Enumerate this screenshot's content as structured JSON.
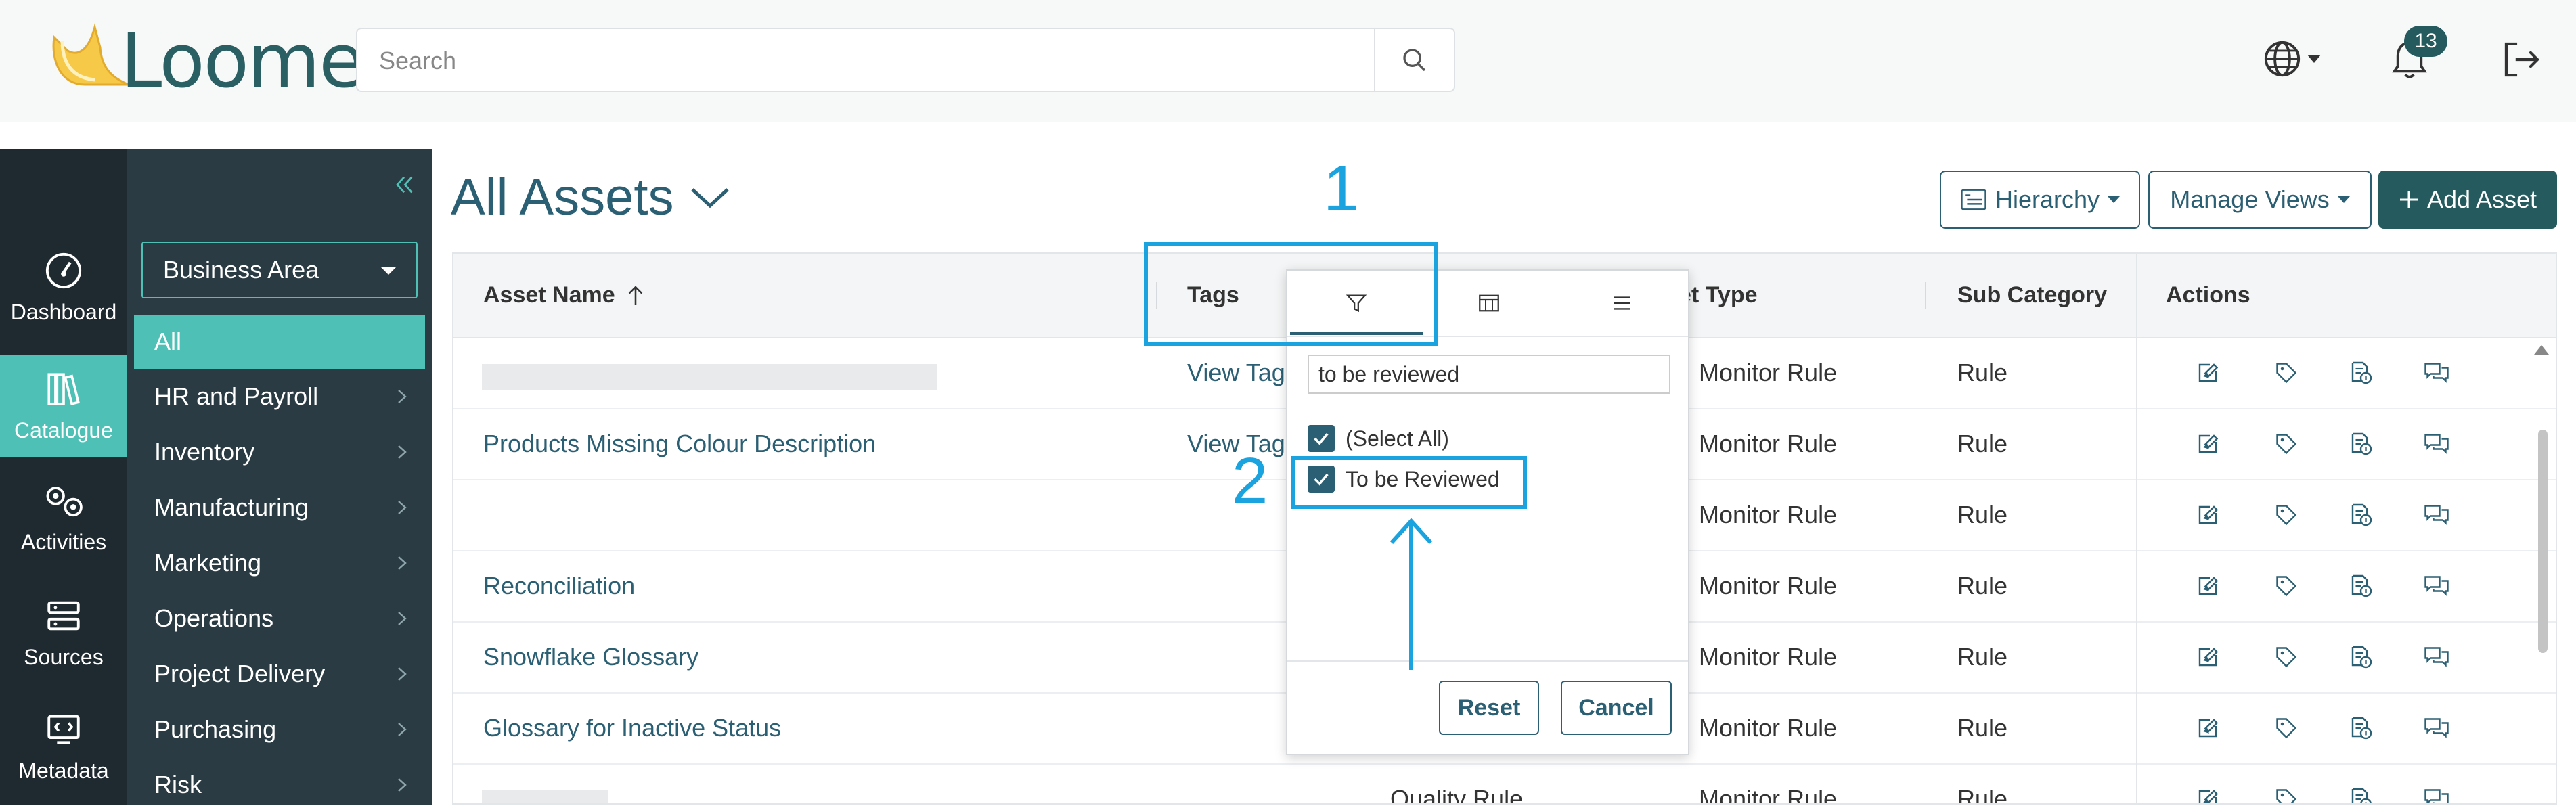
{
  "app": {
    "brand": "Loome"
  },
  "header": {
    "search_placeholder": "Search",
    "notifications_count": "13"
  },
  "rail": {
    "items": [
      {
        "label": "Dashboard",
        "icon": "dashboard-icon"
      },
      {
        "label": "Catalogue",
        "icon": "catalogue-icon",
        "active": true
      },
      {
        "label": "Activities",
        "icon": "activities-icon"
      },
      {
        "label": "Sources",
        "icon": "sources-icon"
      },
      {
        "label": "Metadata",
        "icon": "metadata-icon"
      }
    ]
  },
  "sidebar": {
    "business_area_label": "Business Area",
    "items": [
      {
        "label": "All",
        "active": true
      },
      {
        "label": "HR and Payroll"
      },
      {
        "label": "Inventory"
      },
      {
        "label": "Manufacturing"
      },
      {
        "label": "Marketing"
      },
      {
        "label": "Operations"
      },
      {
        "label": "Project Delivery"
      },
      {
        "label": "Purchasing"
      },
      {
        "label": "Risk"
      }
    ]
  },
  "main": {
    "title": "All Assets",
    "hierarchy_button": "Hierarchy",
    "manage_views_button": "Manage Views",
    "add_asset_button": "Add Asset"
  },
  "table": {
    "columns": {
      "asset_name": "Asset Name",
      "tags": "Tags",
      "asset_type": "et Type",
      "sub_category": "Sub Category",
      "actions": "Actions"
    },
    "rows": [
      {
        "name": "",
        "tags": "View Tags",
        "asset_type": "",
        "type": "Monitor Rule",
        "sub": "Rule"
      },
      {
        "name": "Products Missing Colour Description",
        "tags": "View Tags",
        "asset_type": "",
        "type": "Monitor Rule",
        "sub": "Rule"
      },
      {
        "name": "",
        "tags": "",
        "asset_type": "",
        "type": "Monitor Rule",
        "sub": "Rule"
      },
      {
        "name": "Reconciliation",
        "tags": "",
        "asset_type": "",
        "type": "Monitor Rule",
        "sub": "Rule"
      },
      {
        "name": "Snowflake Glossary",
        "tags": "",
        "asset_type": "",
        "type": "Monitor Rule",
        "sub": "Rule"
      },
      {
        "name": "Glossary for Inactive Status",
        "tags": "",
        "asset_type": "",
        "type": "Monitor Rule",
        "sub": "Rule"
      },
      {
        "name": "",
        "tags": "",
        "asset_type": "Quality Rule",
        "type": "Monitor Rule",
        "sub": "Rule"
      }
    ]
  },
  "filter_popup": {
    "search_value": "to be reviewed",
    "select_all_label": "(Select All)",
    "option_label": "To be Reviewed",
    "reset_button": "Reset",
    "cancel_button": "Cancel"
  },
  "annotations": {
    "step1": "1",
    "step2": "2"
  },
  "colors": {
    "accent": "#4fc0b5",
    "primary": "#255b5e",
    "annotation": "#1aa3de"
  }
}
